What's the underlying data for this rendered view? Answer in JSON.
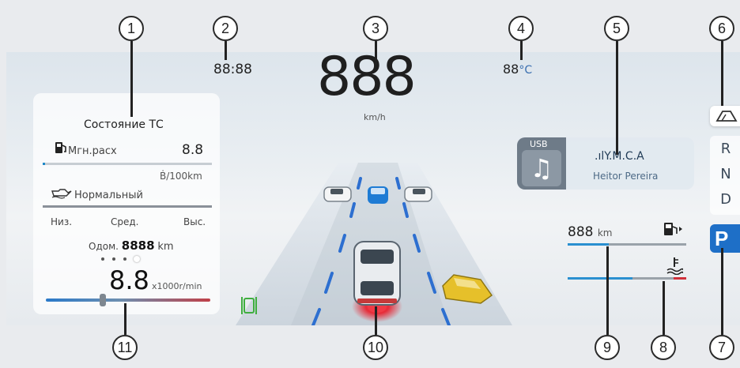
{
  "callouts": [
    "1",
    "2",
    "3",
    "4",
    "5",
    "6",
    "7",
    "8",
    "9",
    "10",
    "11"
  ],
  "clock": "88:88",
  "temperature": {
    "value": "88",
    "unit": "°C"
  },
  "speed": {
    "value": "888",
    "unit": "km/h"
  },
  "vehicle_status": {
    "title": "Состояние ТС",
    "consumption_label": "Мгн.расх",
    "consumption_value": "8.8",
    "consumption_unit": "Ḃ/100km",
    "oil_status": "Нормальный",
    "oil_level_low": "Низ.",
    "oil_level_mid": "Сред.",
    "oil_level_high": "Выс.",
    "odometer_label": "Одом.",
    "odometer_value": "8888",
    "odometer_unit": "km",
    "page_count": 4,
    "active_page": 4,
    "rpm_value": "8.8",
    "rpm_unit": "x1000r/min",
    "rpm_level": 0.3
  },
  "media": {
    "source": "USB",
    "title": ".ılY.M.C.A",
    "artist": "Heitor Pereira"
  },
  "range": {
    "value": "888",
    "unit": "km",
    "fuel_level": 0.35,
    "coolant_level": 0.55
  },
  "gears": [
    "R",
    "N",
    "D"
  ],
  "selected_gear": "P",
  "colors": {
    "accent_blue": "#1e88c8",
    "warning_red": "#e0303a",
    "gear_p": "#1e6fc7"
  }
}
